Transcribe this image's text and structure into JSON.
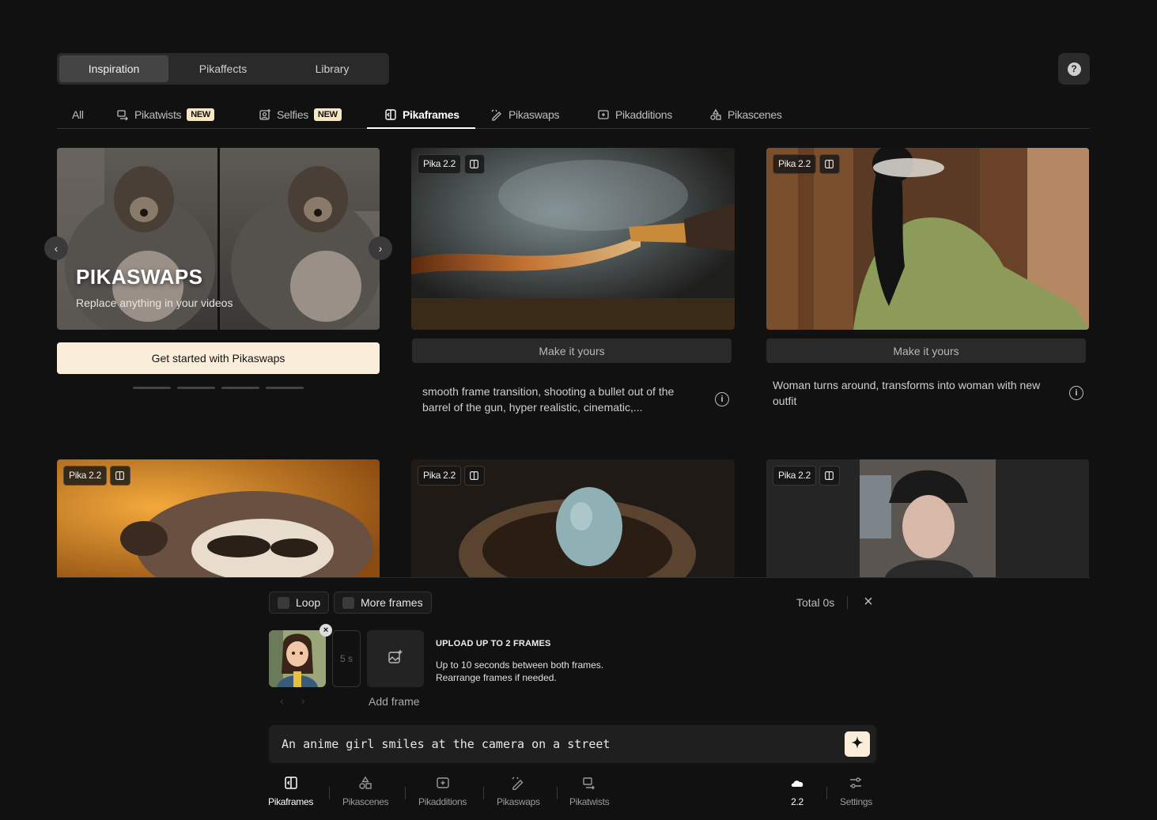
{
  "top_tabs": [
    {
      "label": "Inspiration",
      "active": true
    },
    {
      "label": "Pikaffects",
      "active": false
    },
    {
      "label": "Library",
      "active": false
    }
  ],
  "help_label": "?",
  "filter_tabs": [
    {
      "label": "All",
      "icon": "none"
    },
    {
      "label": "Pikatwists",
      "icon": "twist-icon",
      "badge": "NEW"
    },
    {
      "label": "Selfies",
      "icon": "selfie-icon",
      "badge": "NEW"
    },
    {
      "label": "Pikaframes",
      "icon": "frames-icon",
      "active": true
    },
    {
      "label": "Pikaswaps",
      "icon": "swap-icon"
    },
    {
      "label": "Pikadditions",
      "icon": "additions-icon"
    },
    {
      "label": "Pikascenes",
      "icon": "scenes-icon"
    }
  ],
  "hero": {
    "title": "PIKASWAPS",
    "subtitle": "Replace anything in your videos",
    "cta": "Get started with Pikaswaps"
  },
  "cards": [
    {
      "model": "Pika 2.2",
      "action": "Make it yours",
      "prompt": "smooth frame transition, shooting a bullet out of the barrel of the gun, hyper realistic, cinematic,..."
    },
    {
      "model": "Pika 2.2",
      "action": "Make it yours",
      "prompt": "Woman turns around, transforms into woman with new outfit"
    },
    {
      "model": "Pika 2.2"
    },
    {
      "model": "Pika 2.2"
    },
    {
      "model": "Pika 2.2"
    }
  ],
  "panel": {
    "loop_label": "Loop",
    "more_frames_label": "More frames",
    "total_label": "Total 0s",
    "duration": "5 s",
    "add_frame_label": "Add frame",
    "upload_title": "UPLOAD UP TO 2 FRAMES",
    "upload_line1": "Up to 10 seconds between both frames.",
    "upload_line2": "Rearrange frames if needed.",
    "prompt_value": "An anime girl smiles at the camera on a street"
  },
  "toolbar": [
    {
      "label": "Pikaframes",
      "active": true
    },
    {
      "label": "Pikascenes"
    },
    {
      "label": "Pikadditions"
    },
    {
      "label": "Pikaswaps"
    },
    {
      "label": "Pikatwists"
    },
    {
      "label": "2.2"
    },
    {
      "label": "Settings"
    }
  ]
}
